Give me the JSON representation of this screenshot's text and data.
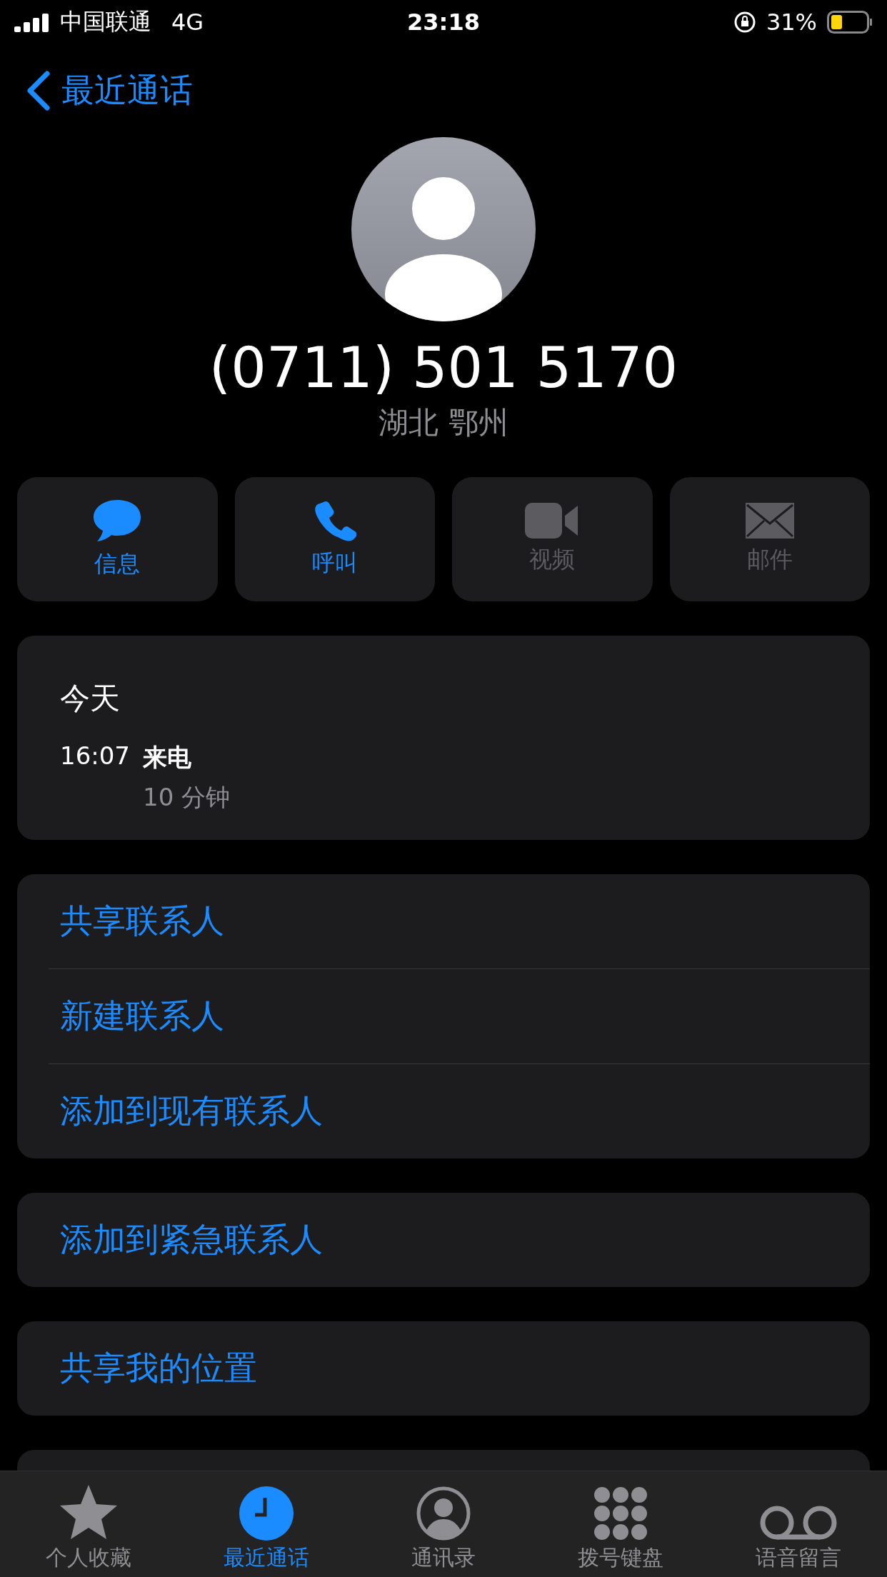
{
  "status_bar": {
    "carrier": "中国联通",
    "network": "4G",
    "time": "23:18",
    "battery_percent": "31%"
  },
  "nav": {
    "back_label": "最近通话"
  },
  "contact": {
    "number": "(0711) 501 5170",
    "location": "湖北 鄂州"
  },
  "actions": [
    {
      "kind": "message",
      "label": "信息",
      "disabled": false
    },
    {
      "kind": "call",
      "label": "呼叫",
      "disabled": false
    },
    {
      "kind": "video",
      "label": "视频",
      "disabled": true
    },
    {
      "kind": "mail",
      "label": "邮件",
      "disabled": true
    }
  ],
  "history": {
    "day": "今天",
    "calls": [
      {
        "time": "16:07",
        "type": "来电",
        "duration": "10 分钟"
      }
    ]
  },
  "option_groups": [
    [
      "共享联系人",
      "新建联系人",
      "添加到现有联系人"
    ],
    [
      "添加到紧急联系人"
    ],
    [
      "共享我的位置"
    ]
  ],
  "tabs": [
    {
      "kind": "star",
      "label": "个人收藏",
      "selected": false
    },
    {
      "kind": "clock",
      "label": "最近通话",
      "selected": true
    },
    {
      "kind": "person",
      "label": "通讯录",
      "selected": false
    },
    {
      "kind": "keypad",
      "label": "拨号键盘",
      "selected": false
    },
    {
      "kind": "voicemail",
      "label": "语音留言",
      "selected": false
    }
  ]
}
